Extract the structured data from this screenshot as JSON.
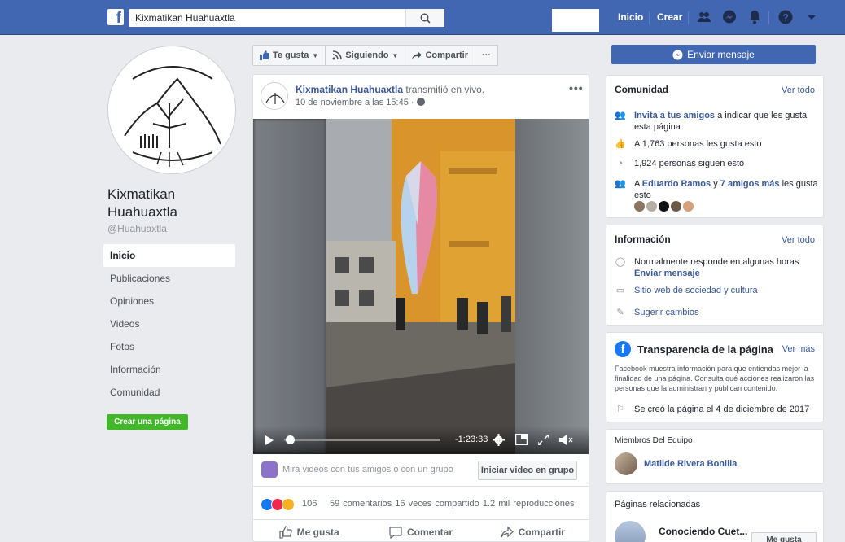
{
  "topbar": {
    "logo": "f",
    "search_value": "Kixmatikan Huahuaxtla",
    "nav_home": "Inicio",
    "nav_create": "Crear",
    "colors": {
      "bar": "#4267b2",
      "text": "#ffffff"
    }
  },
  "left": {
    "page_name": "Kixmatikan Huahuaxtla",
    "handle": "@Huahuaxtla",
    "nav": [
      "Inicio",
      "Publicaciones",
      "Opiniones",
      "Videos",
      "Fotos",
      "Información",
      "Comunidad"
    ],
    "create_page": "Crear una página"
  },
  "actions": {
    "like": "Te gusta",
    "following": "Siguiendo",
    "share": "Compartir",
    "more": "···"
  },
  "post": {
    "author": "Kixmatikan Huahuaxtla",
    "verb": "transmitió en vivo.",
    "date": "10 de noviembre a las 15:45 ·",
    "more": "•••",
    "time_remaining": "-1:23:33",
    "group_text": "Mira videos con tus amigos o con un grupo",
    "group_button": "Iniciar video en grupo",
    "reactions_count": "106",
    "comments": "59 comentarios",
    "shares": "16 veces compartido",
    "views": "1.2 mil reproducciones",
    "btn_like": "Me gusta",
    "btn_comment": "Comentar",
    "btn_share": "Compartir"
  },
  "right": {
    "send_message": "Enviar mensaje",
    "community": {
      "title": "Comunidad",
      "link": "Ver todo",
      "invite_link": "Invita a tus amigos",
      "invite_rest": "a indicar que les gusta esta página",
      "likes": "A 1,763 personas les gusta esto",
      "follows": "1,924 personas siguen esto",
      "friends_prefix": "A",
      "friends_name": "Eduardo Ramos",
      "friends_mid": "y",
      "friends_more": "7 amigos más",
      "friends_suffix": "les gusta esto"
    },
    "info": {
      "title": "Información",
      "link": "Ver todo",
      "responds": "Normalmente responde en algunas horas",
      "send_message": "Enviar mensaje",
      "website": "Sitio web de sociedad y cultura",
      "suggest": "Sugerir cambios"
    },
    "transparency": {
      "title": "Transparencia de la página",
      "link": "Ver más",
      "text": "Facebook muestra información para que entiendas mejor la finalidad de una página. Consulta qué acciones realizaron las personas que la administran y publican contenido.",
      "created": "Se creó la página el 4 de diciembre de 2017"
    },
    "team": {
      "title": "Miembros Del Equipo",
      "member": "Matilde Rivera Bonilla"
    },
    "related": {
      "title": "Páginas relacionadas",
      "page": "Conociendo Cuet...",
      "like_button": "Me gusta"
    }
  }
}
